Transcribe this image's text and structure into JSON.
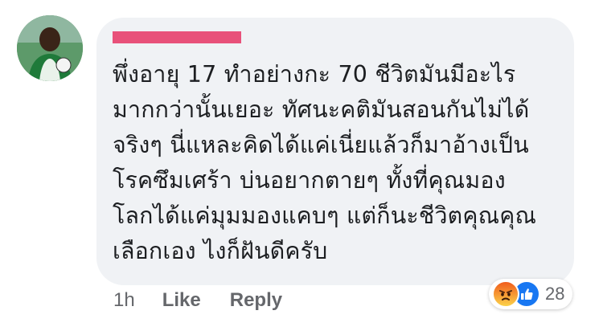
{
  "avatar": {
    "icon": "profile-photo"
  },
  "comment": {
    "author_name_redacted": true,
    "lines": [
      "พึ่งอายุ 17 ทำอย่างกะ 70 ชีวิตมันมีอะไร",
      "มากกว่านั้นเยอะ ทัศนะคติมันสอนกันไม่ได้",
      "จริงๆ นี่แหละคิดได้แค่เนี่ยแล้วก็มาอ้างเป็น",
      "โรคซึมเศร้า บ่นอยากตายๆ ทั้งที่คุณมอง",
      "โลกได้แค่มุมมองแคบๆ แต่ก็นะชีวิตคุณคุณ",
      "เลือกเอง ไงก็ฝันดีครับ"
    ]
  },
  "reactions": {
    "types": [
      "angry",
      "like"
    ],
    "count": "28"
  },
  "actions": {
    "timestamp": "1h",
    "like_label": "Like",
    "reply_label": "Reply"
  },
  "colors": {
    "bubble": "#f0f2f5",
    "text": "#1c1e21",
    "secondary_text": "#65676b",
    "redaction": "#e8517a",
    "like_blue": "#1877f2"
  }
}
